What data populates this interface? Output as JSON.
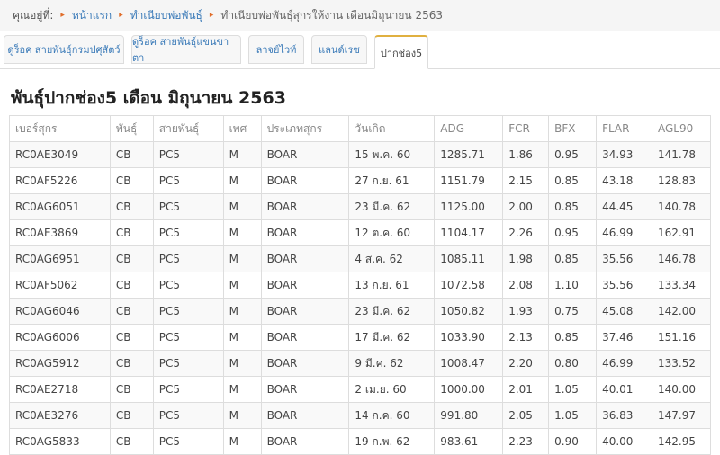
{
  "breadcrumb": {
    "prefix": "คุณอยู่ที่",
    "items": [
      "หน้าแรก",
      "ทำเนียบพ่อพันธุ์",
      "ทำเนียบพ่อพันธุ์สุกรให้งาน เดือนมิถุนายน 2563"
    ]
  },
  "tabs": [
    {
      "label": "ดูร็อค สายพันธุ์กรมปศุสัตว์"
    },
    {
      "label": "ดูร็อค สายพันธุ์แขนขาตา"
    },
    {
      "label": "ลาจย์ไวท์"
    },
    {
      "label": "แลนด์เรซ"
    },
    {
      "label": "ปากช่อง5"
    }
  ],
  "active_tab": "ปากช่อง5",
  "page_title": "พันธุ์ปากช่อง5 เดือน มิถุนายน 2563",
  "table": {
    "headers": [
      "เบอร์สุกร",
      "พันธุ์",
      "สายพันธุ์",
      "เพศ",
      "ประเภทสุกร",
      "วันเกิด",
      "ADG",
      "FCR",
      "BFX",
      "FLAR",
      "AGL90"
    ],
    "rows": [
      [
        "RC0AE3049",
        "CB",
        "PC5",
        "M",
        "BOAR",
        "15 พ.ค. 60",
        "1285.71",
        "1.86",
        "0.95",
        "34.93",
        "141.78"
      ],
      [
        "RC0AF5226",
        "CB",
        "PC5",
        "M",
        "BOAR",
        "27 ก.ย. 61",
        "1151.79",
        "2.15",
        "0.85",
        "43.18",
        "128.83"
      ],
      [
        "RC0AG6051",
        "CB",
        "PC5",
        "M",
        "BOAR",
        "23 มี.ค. 62",
        "1125.00",
        "2.00",
        "0.85",
        "44.45",
        "140.78"
      ],
      [
        "RC0AE3869",
        "CB",
        "PC5",
        "M",
        "BOAR",
        "12 ต.ค. 60",
        "1104.17",
        "2.26",
        "0.95",
        "46.99",
        "162.91"
      ],
      [
        "RC0AG6951",
        "CB",
        "PC5",
        "M",
        "BOAR",
        "4 ส.ค. 62",
        "1085.11",
        "1.98",
        "0.85",
        "35.56",
        "146.78"
      ],
      [
        "RC0AF5062",
        "CB",
        "PC5",
        "M",
        "BOAR",
        "13 ก.ย. 61",
        "1072.58",
        "2.08",
        "1.10",
        "35.56",
        "133.34"
      ],
      [
        "RC0AG6046",
        "CB",
        "PC5",
        "M",
        "BOAR",
        "23 มี.ค. 62",
        "1050.82",
        "1.93",
        "0.75",
        "45.08",
        "142.00"
      ],
      [
        "RC0AG6006",
        "CB",
        "PC5",
        "M",
        "BOAR",
        "17 มี.ค. 62",
        "1033.90",
        "2.13",
        "0.85",
        "37.46",
        "151.16"
      ],
      [
        "RC0AG5912",
        "CB",
        "PC5",
        "M",
        "BOAR",
        "9 มี.ค. 62",
        "1008.47",
        "2.20",
        "0.80",
        "46.99",
        "133.52"
      ],
      [
        "RC0AE2718",
        "CB",
        "PC5",
        "M",
        "BOAR",
        "2 เม.ย. 60",
        "1000.00",
        "2.01",
        "1.05",
        "40.01",
        "140.00"
      ],
      [
        "RC0AE3276",
        "CB",
        "PC5",
        "M",
        "BOAR",
        "14 ก.ค. 60",
        "991.80",
        "2.05",
        "1.05",
        "36.83",
        "147.97"
      ],
      [
        "RC0AG5833",
        "CB",
        "PC5",
        "M",
        "BOAR",
        "19 ก.พ. 62",
        "983.61",
        "2.23",
        "0.90",
        "40.00",
        "142.95"
      ]
    ]
  },
  "colors": {
    "link": "#3a7ab8",
    "separator": "#e06d2a",
    "active_tab_border": "#e0b040",
    "breadcrumb_bg": "#f5f5f5"
  }
}
